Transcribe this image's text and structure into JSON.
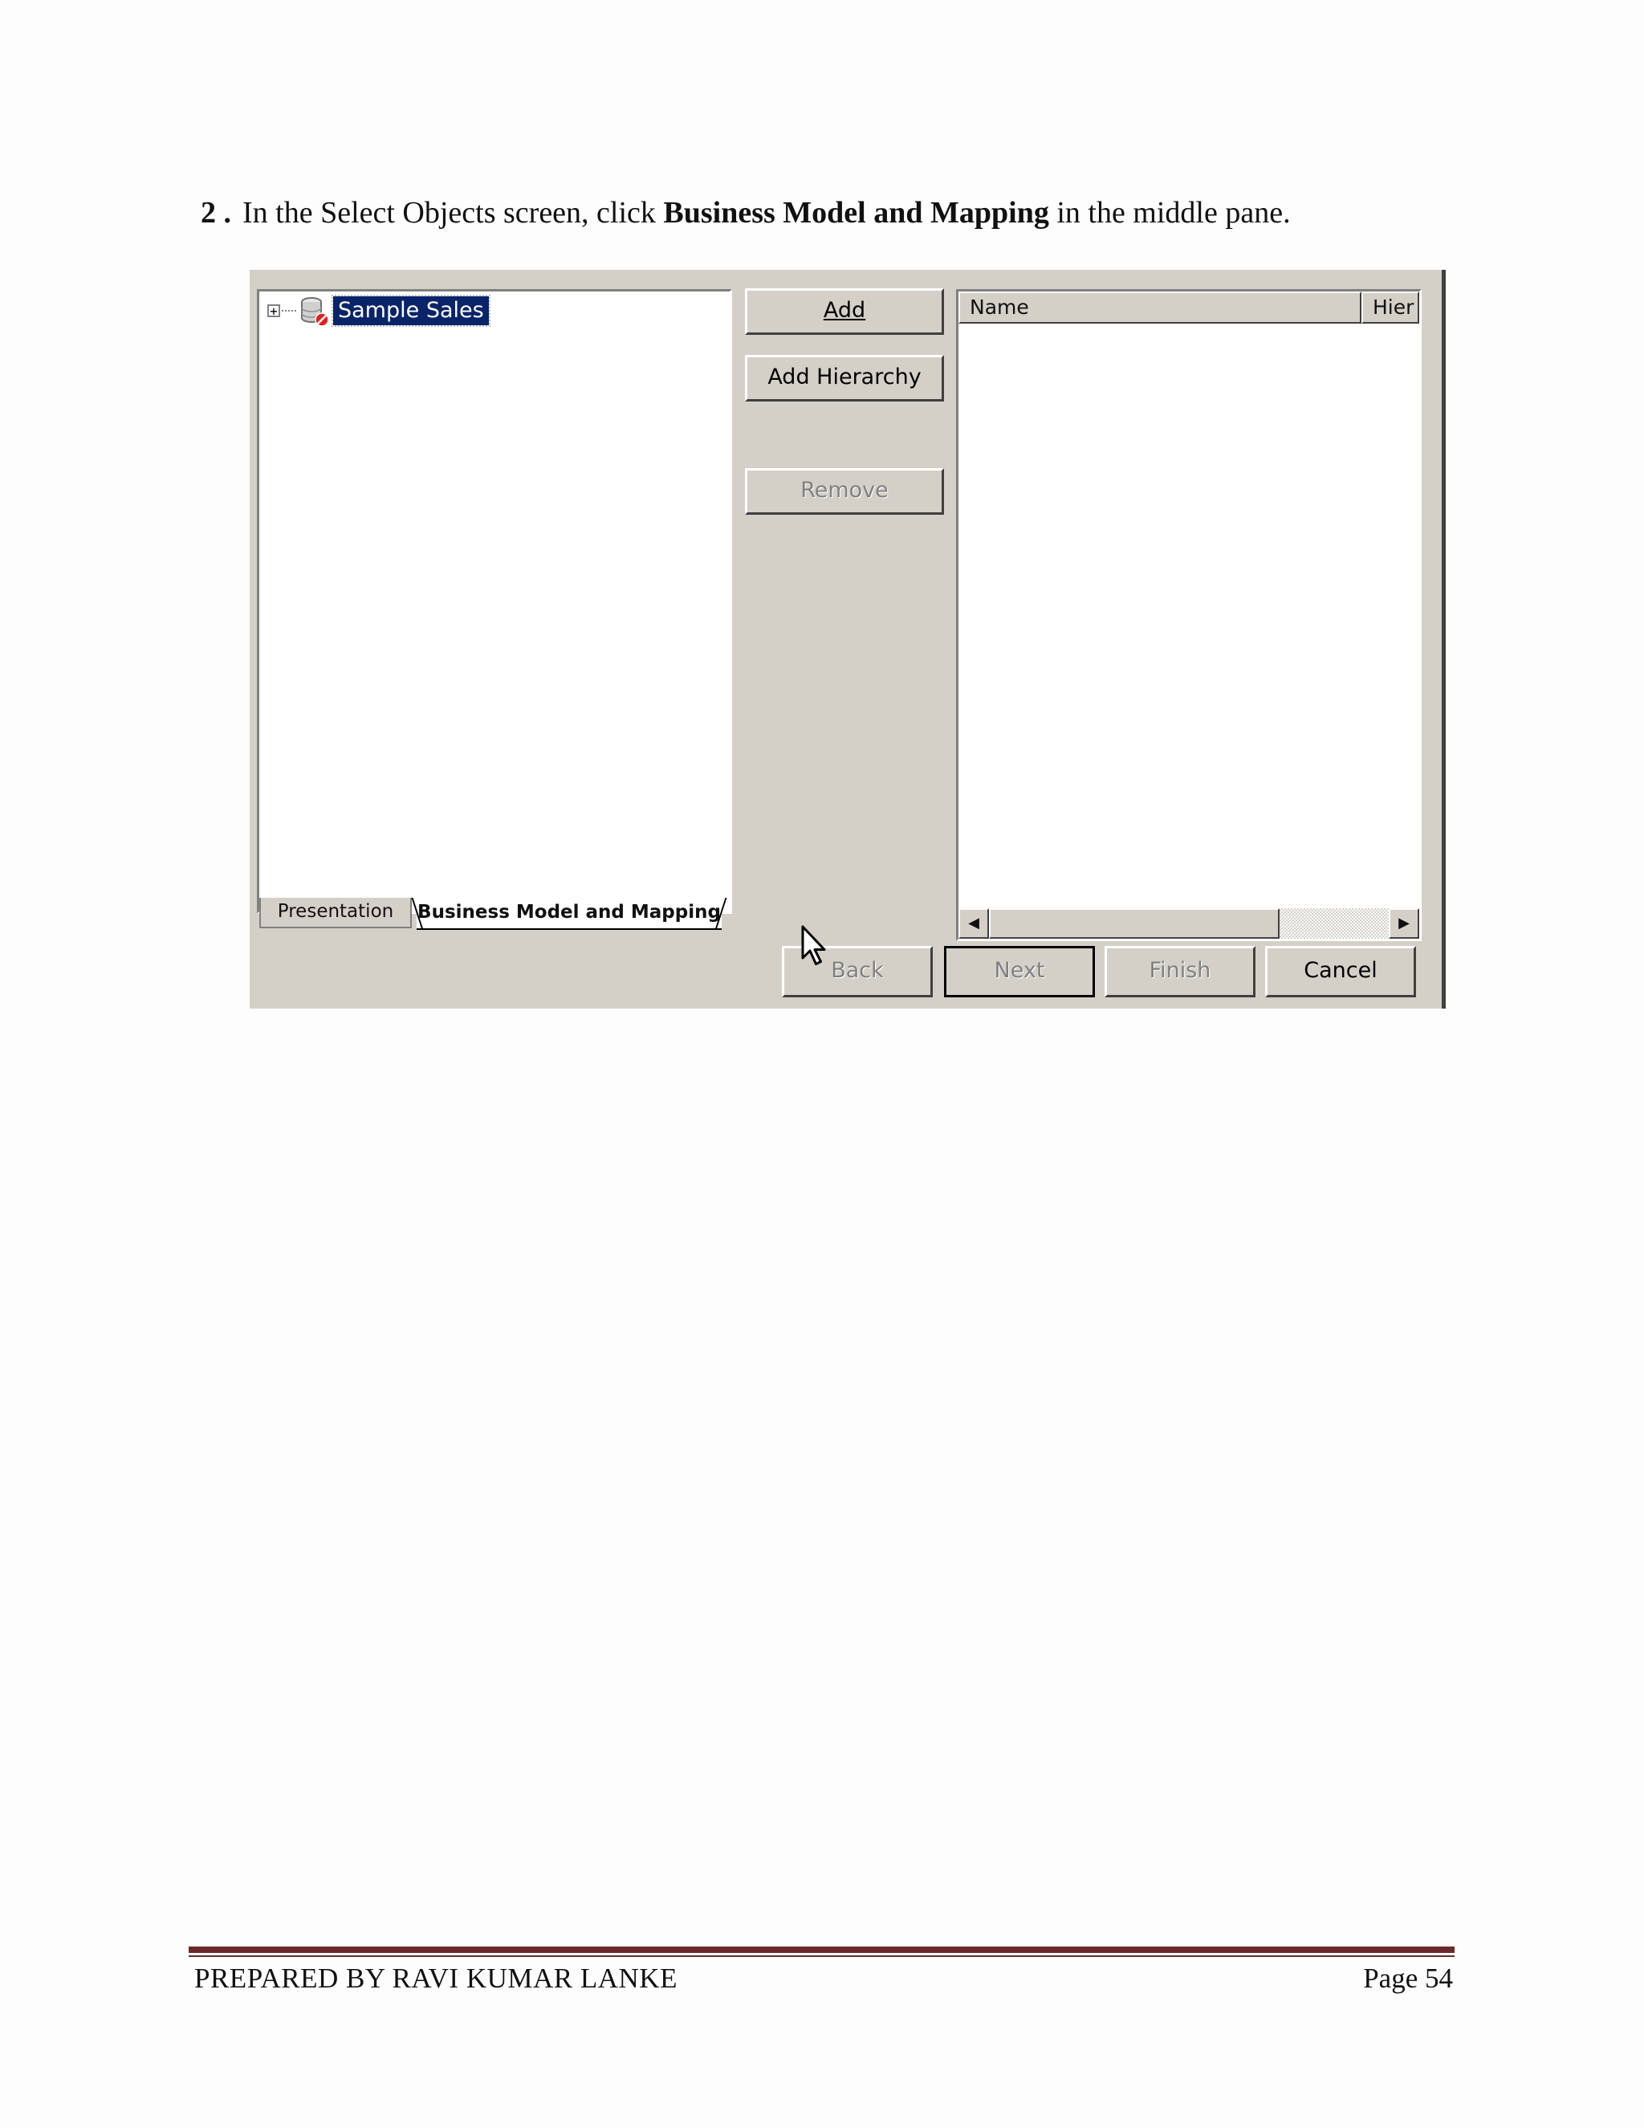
{
  "instruction": {
    "number": "2 .",
    "text_before": "In the Select Objects screen, click ",
    "bold": "Business Model and Mapping",
    "text_after": " in the middle pane."
  },
  "dialog": {
    "tree": {
      "expander": "+",
      "root_label": "Sample Sales",
      "icon": "database-icon"
    },
    "tabs": {
      "presentation": "Presentation",
      "business": "Business Model and Mapping"
    },
    "buttons": {
      "add": "Add",
      "add_hierarchy": "Add Hierarchy",
      "remove": "Remove",
      "back": "Back",
      "next": "Next",
      "finish": "Finish",
      "cancel": "Cancel"
    },
    "list": {
      "columns": [
        "Name",
        "Hier"
      ]
    }
  },
  "footer": {
    "left": "PREPARED BY RAVI KUMAR LANKE",
    "right": "Page 54"
  },
  "colors": {
    "footer_rule": "#6b2a2a",
    "selection": "#0a246a",
    "dialog_bg": "#d4d0c8"
  }
}
